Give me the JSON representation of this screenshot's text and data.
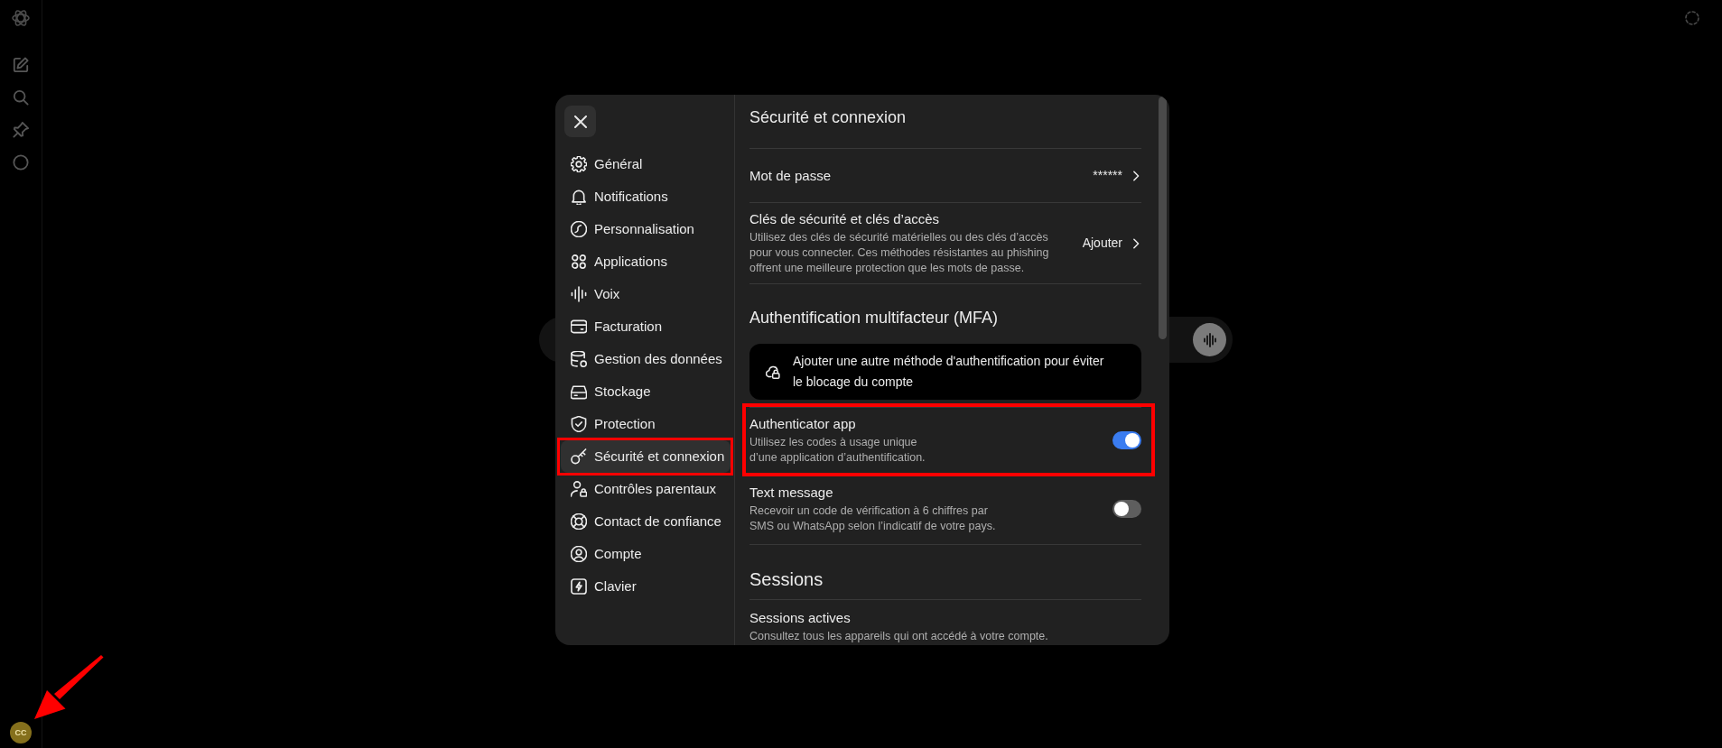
{
  "rail": {
    "avatar": {
      "initials": "CC",
      "annotated": true
    }
  },
  "settings": {
    "nav": [
      {
        "label": "Général",
        "selected": false,
        "annotated": false
      },
      {
        "label": "Notifications",
        "selected": false,
        "annotated": false
      },
      {
        "label": "Personnalisation",
        "selected": false,
        "annotated": false
      },
      {
        "label": "Applications",
        "selected": false,
        "annotated": false
      },
      {
        "label": "Voix",
        "selected": false,
        "annotated": false
      },
      {
        "label": "Facturation",
        "selected": false,
        "annotated": false
      },
      {
        "label": "Gestion des données",
        "selected": false,
        "annotated": false
      },
      {
        "label": "Stockage",
        "selected": false,
        "annotated": false
      },
      {
        "label": "Protection",
        "selected": false,
        "annotated": false
      },
      {
        "label": "Sécurité et connexion",
        "selected": true,
        "annotated": true
      },
      {
        "label": "Contrôles parentaux",
        "selected": false,
        "annotated": false
      },
      {
        "label": "Contact de confiance",
        "selected": false,
        "annotated": false
      },
      {
        "label": "Compte",
        "selected": false,
        "annotated": false
      },
      {
        "label": "Clavier",
        "selected": false,
        "annotated": false
      }
    ],
    "title": "Sécurité et connexion",
    "sections": [
      {
        "rows": [
          {
            "kind": "link",
            "label": "Mot de passe",
            "value": "******",
            "annotated": false
          },
          {
            "kind": "link",
            "label": "Clés de sécurité et clés d’accès",
            "description": "Utilisez des clés de sécurité matérielles ou des clés d’accès\npour vous connecter. Ces méthodes résistantes au phishing\noffrent une meilleure protection que les mots de passe.",
            "value": "Ajouter",
            "annotated": false
          }
        ]
      },
      {
        "heading": "Authentification multifacteur (MFA)",
        "notice": "Ajouter une autre méthode d'authentification pour éviter\nle blocage du compte",
        "rows": [
          {
            "kind": "toggle",
            "label": "Authenticator app",
            "description": "Utilisez les codes à usage unique\nd’une application d’authentification.",
            "on": true,
            "annotated": true
          },
          {
            "kind": "toggle",
            "label": "Text message",
            "description": "Recevoir un code de vérification à 6 chiffres par\nSMS ou WhatsApp selon l’indicatif de votre pays.",
            "on": false,
            "annotated": false
          }
        ]
      },
      {
        "heading": "Sessions",
        "rows": [
          {
            "kind": "info",
            "label": "Sessions actives",
            "description": "Consultez tous les appareils qui ont accédé à votre compte.",
            "annotated": false
          }
        ]
      }
    ]
  }
}
